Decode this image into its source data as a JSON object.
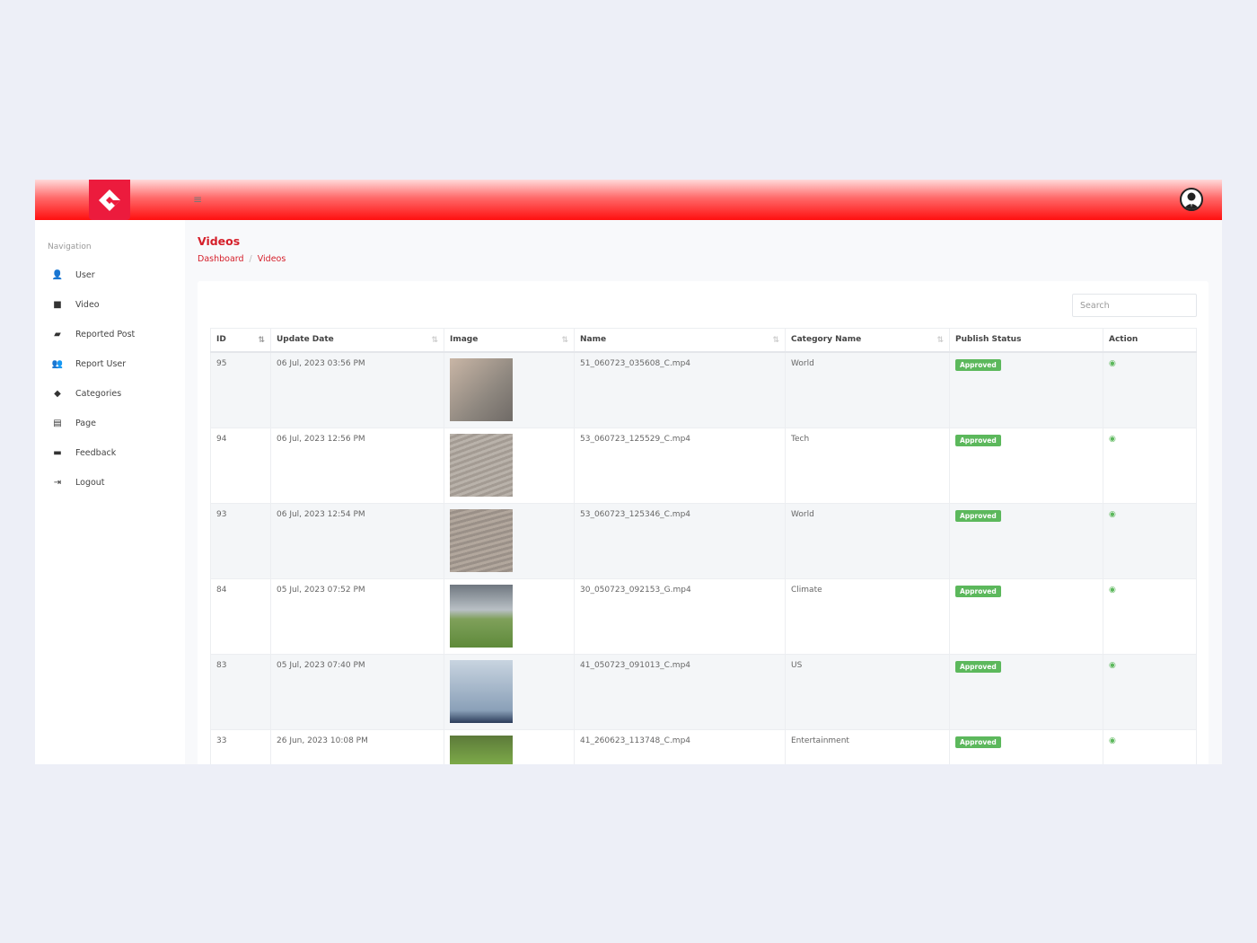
{
  "header": {
    "menu_icon": "hamburger-icon",
    "avatar_icon": "user-avatar-icon",
    "brand_color": "#ec1b3d"
  },
  "sidebar": {
    "label": "Navigation",
    "items": [
      {
        "label": "User",
        "icon": "user-icon",
        "glyph": "👤"
      },
      {
        "label": "Video",
        "icon": "video-camera-icon",
        "glyph": "■"
      },
      {
        "label": "Reported Post",
        "icon": "video-slash-icon",
        "glyph": "▰"
      },
      {
        "label": "Report User",
        "icon": "user-plus-icon",
        "glyph": "👥"
      },
      {
        "label": "Categories",
        "icon": "tags-icon",
        "glyph": "◆"
      },
      {
        "label": "Page",
        "icon": "file-icon",
        "glyph": "▤"
      },
      {
        "label": "Feedback",
        "icon": "comment-dots-icon",
        "glyph": "▬"
      },
      {
        "label": "Logout",
        "icon": "logout-icon",
        "glyph": "⇥"
      }
    ]
  },
  "page": {
    "title": "Videos",
    "breadcrumb": [
      "Dashboard",
      "Videos"
    ]
  },
  "search": {
    "placeholder": "Search"
  },
  "table": {
    "columns": [
      "ID",
      "Update Date",
      "Image",
      "Name",
      "Category Name",
      "Publish Status",
      "Action"
    ],
    "rows": [
      {
        "id": "95",
        "date": "06 Jul, 2023 03:56 PM",
        "name": "51_060723_035608_C.mp4",
        "category": "World",
        "status": "Approved"
      },
      {
        "id": "94",
        "date": "06 Jul, 2023 12:56 PM",
        "name": "53_060723_125529_C.mp4",
        "category": "Tech",
        "status": "Approved"
      },
      {
        "id": "93",
        "date": "06 Jul, 2023 12:54 PM",
        "name": "53_060723_125346_C.mp4",
        "category": "World",
        "status": "Approved"
      },
      {
        "id": "84",
        "date": "05 Jul, 2023 07:52 PM",
        "name": "30_050723_092153_G.mp4",
        "category": "Climate",
        "status": "Approved"
      },
      {
        "id": "83",
        "date": "05 Jul, 2023 07:40 PM",
        "name": "41_050723_091013_C.mp4",
        "category": "US",
        "status": "Approved"
      },
      {
        "id": "33",
        "date": "26 Jun, 2023 10:08 PM",
        "name": "41_260623_113748_C.mp4",
        "category": "Entertainment",
        "status": "Approved"
      }
    ]
  },
  "colors": {
    "accent": "#d51f2a",
    "approved": "#5cb85c"
  }
}
